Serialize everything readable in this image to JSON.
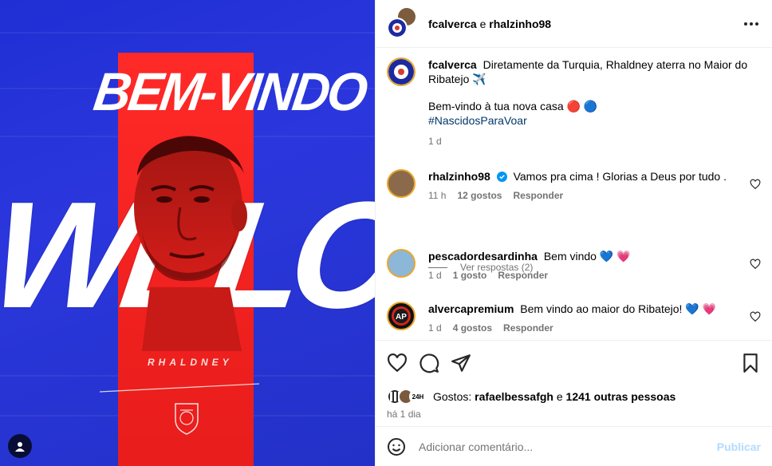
{
  "image": {
    "headline": "BEM-VINDO",
    "background_word": "WELCOME",
    "player_name": "RHALDNEY"
  },
  "header": {
    "user1": "fcalverca",
    "conjunction": "e",
    "user2": "rhalzinho98"
  },
  "caption": {
    "username": "fcalverca",
    "line1": "Diretamente da Turquia, Rhaldney aterra no Maior do Ribatejo ✈️",
    "line2": "Bem-vindo à tua nova casa 🔴 🔵",
    "hashtag": "#NascidosParaVoar",
    "time": "1 d"
  },
  "comments": [
    {
      "username": "rhalzinho98",
      "verified": true,
      "text": "Vamos pra cima ! Glorias a Deus por tudo .",
      "time": "11 h",
      "likes": "12 gostos",
      "reply": "Responder"
    },
    {
      "username": "pescadordesardinha",
      "text": "Bem vindo 💙 💗",
      "time": "1 d",
      "likes": "1 gosto",
      "reply": "Responder"
    },
    {
      "username": "alvercapremium",
      "text": "Bem vindo ao maior do Ribatejo! 💙 💗",
      "time": "1 d",
      "likes": "4 gostos",
      "reply": "Responder"
    }
  ],
  "view_replies": "Ver respostas (2)",
  "likes": {
    "prefix": "Gostos:",
    "user": "rafaelbessafgh",
    "middle": "e",
    "others": "1241 outras pessoas",
    "badge": "24H"
  },
  "date": "há 1 dia",
  "add_comment": {
    "placeholder": "Adicionar comentário...",
    "publish": "Publicar"
  },
  "colors": {
    "accent_blue": "#0095f6",
    "publish_disabled": "#b3dbff",
    "hashtag": "#00376b",
    "brand_blue": "#2b37dd",
    "brand_red": "#f0211f"
  }
}
